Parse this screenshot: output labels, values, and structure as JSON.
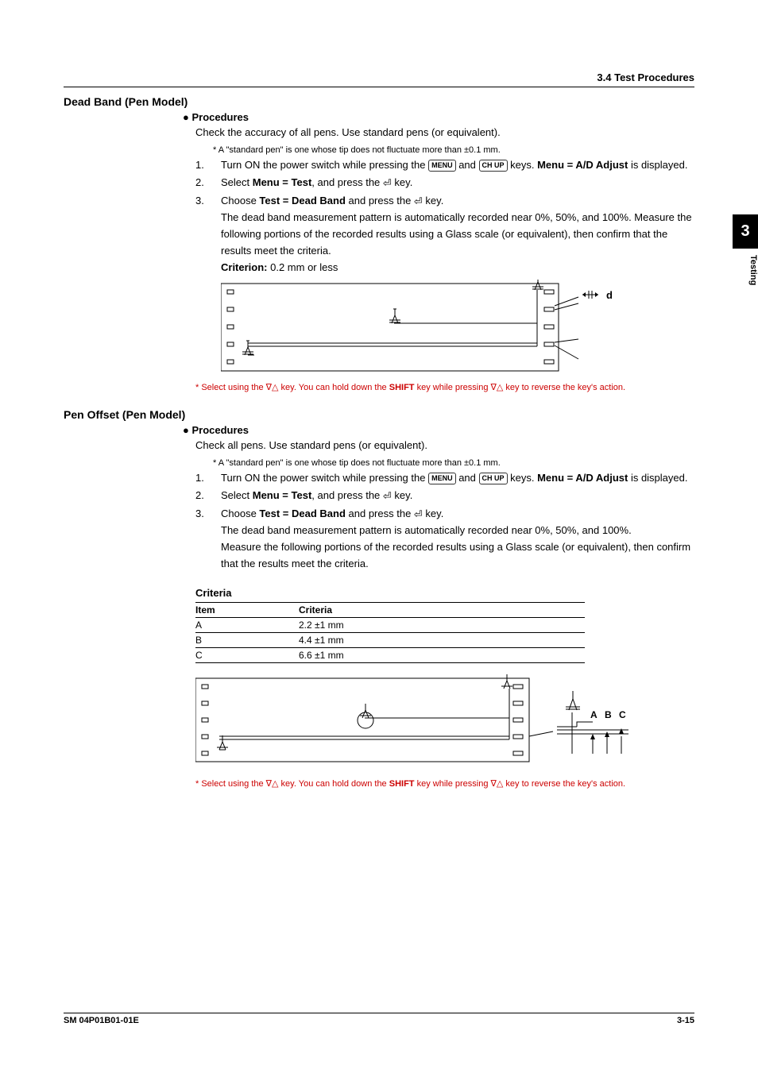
{
  "header": {
    "right": "3.4  Test Procedures"
  },
  "side_tab": {
    "number": "3",
    "label": "Testing"
  },
  "sections": {
    "dead_band": {
      "title": "Dead Band (Pen Model)",
      "procedures_label": "●  Procedures",
      "intro": "Check the accuracy of all pens.  Use standard pens (or equivalent).",
      "star_note": "*   A \"standard pen\" is one whose tip does not fluctuate more than ±0.1 mm.",
      "steps": {
        "s1_pre": "Turn ON the power switch while pressing the ",
        "s1_mid": " and ",
        "s1_post1": " keys.  ",
        "s1_bold": "Menu = A/D Adjust",
        "s1_post2": " is displayed.",
        "s2_pre": "Select ",
        "s2_bold": "Menu = Test",
        "s2_mid": ", and press the ",
        "s2_post": " key.",
        "s3_pre": "Choose ",
        "s3_bold": "Test = Dead Band",
        "s3_mid": " and press the ",
        "s3_post": " key.",
        "s3_body": "The dead band measurement pattern is automatically recorded near 0%, 50%, and 100%.  Measure the following portions of the recorded results using a Glass scale (or equivalent), then confirm that the results meet the criteria.",
        "criterion_label": "Criterion:",
        "criterion_value": " 0.2 mm or less"
      },
      "diagram_d_label": "d",
      "red_note_pre": "*  Select using the ",
      "red_note_mid": " key.   You can hold down the ",
      "red_note_bold": "SHIFT",
      "red_note_mid2": " key while pressing ",
      "red_note_post": " key to reverse the key's action."
    },
    "pen_offset": {
      "title": "Pen  Offset (Pen Model)",
      "procedures_label": "●  Procedures",
      "intro": "Check all pens.  Use standard pens (or equivalent).",
      "star_note": "*   A \"standard pen\" is one whose tip does not fluctuate more than ±0.1 mm.",
      "steps": {
        "s1_pre": "Turn ON the power switch while pressing the ",
        "s1_mid": " and ",
        "s1_post1": " keys.  ",
        "s1_bold": "Menu = A/D Adjust",
        "s1_post2": " is displayed.",
        "s2_pre": "Select ",
        "s2_bold": "Menu = Test",
        "s2_mid": ", and press the ",
        "s2_post": " key.",
        "s3_pre": "Choose ",
        "s3_bold": "Test = Dead Band",
        "s3_mid": " and press the ",
        "s3_post": " key.",
        "s3_body1": "The dead band measurement pattern is automatically recorded near 0%, 50%, and 100%.",
        "s3_body2": "Measure the following portions of the recorded results using a Glass scale (or equivalent), then confirm that the results meet the criteria."
      },
      "criteria_title": "Criteria",
      "criteria_table": {
        "headers": [
          "Item",
          "Criteria"
        ],
        "rows": [
          [
            "A",
            "2.2 ±1 mm"
          ],
          [
            "B",
            "4.4 ±1 mm"
          ],
          [
            "C",
            "6.6 ±1 mm"
          ]
        ]
      },
      "diagram_abc_labels": {
        "a": "A",
        "b": "B",
        "c": "C"
      },
      "red_note_pre": "*  Select using the ",
      "red_note_mid": " key.   You can hold down the ",
      "red_note_bold": "SHIFT",
      "red_note_mid2": " key while pressing ",
      "red_note_post": " key to reverse the key's action."
    }
  },
  "keys": {
    "menu": "MENU",
    "chup": "CH UP",
    "nabla": "∇△",
    "enter": "↵"
  },
  "footer": {
    "left": "SM 04P01B01-01E",
    "right": "3-15"
  }
}
